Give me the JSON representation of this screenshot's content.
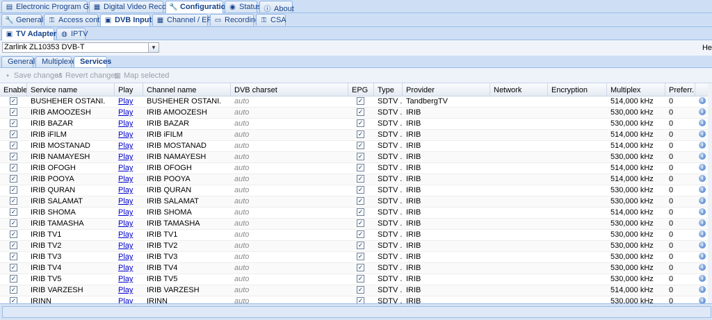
{
  "main_tabs": [
    {
      "label": "Electronic Program Guide",
      "icon": "book-icon"
    },
    {
      "label": "Digital Video Recorder",
      "icon": "film-icon"
    },
    {
      "label": "Configuration",
      "icon": "wrench-icon"
    },
    {
      "label": "Status",
      "icon": "eye-icon"
    },
    {
      "label": "About",
      "icon": "info-icon"
    }
  ],
  "config_tabs": [
    {
      "label": "General",
      "icon": "wrench-icon"
    },
    {
      "label": "Access control",
      "icon": "key-icon"
    },
    {
      "label": "DVB Inputs",
      "icon": "tv-icon"
    },
    {
      "label": "Channel / EPG",
      "icon": "table-icon"
    },
    {
      "label": "Recording",
      "icon": "drive-icon"
    },
    {
      "label": "CSA",
      "icon": "key-icon"
    }
  ],
  "dvb_tabs": [
    {
      "label": "TV Adapters",
      "icon": "tv-icon"
    },
    {
      "label": "IPTV",
      "icon": "globe-icon"
    }
  ],
  "adapter": {
    "selected": "Zarlink ZL10353 DVB-T"
  },
  "help_label": "He",
  "sub_tabs": [
    {
      "label": "General"
    },
    {
      "label": "Multiplexes"
    },
    {
      "label": "Services"
    }
  ],
  "toolbar": {
    "save": "Save changes",
    "revert": "Revert changes",
    "map": "Map selected"
  },
  "columns": [
    "Enabled",
    "Service name",
    "Play",
    "Channel name",
    "DVB charset",
    "EPG",
    "Type",
    "Provider",
    "Network",
    "Encryption",
    "Multiplex",
    "Preferr..."
  ],
  "rows": [
    {
      "service": "BUSHEHER OSTANI.",
      "play": "Play",
      "channel": "BUSHEHER OSTANI.",
      "charset": "auto",
      "type": "SDTV ...",
      "provider": "TandbergTV",
      "network": "",
      "encryption": "",
      "multiplex": "514,000 kHz",
      "pref": "0"
    },
    {
      "service": "IRIB AMOOZESH",
      "play": "Play",
      "channel": "IRIB AMOOZESH",
      "charset": "auto",
      "type": "SDTV ...",
      "provider": "IRIB",
      "network": "",
      "encryption": "",
      "multiplex": "530,000 kHz",
      "pref": "0"
    },
    {
      "service": "IRIB BAZAR",
      "play": "Play",
      "channel": "IRIB BAZAR",
      "charset": "auto",
      "type": "SDTV ...",
      "provider": "IRIB",
      "network": "",
      "encryption": "",
      "multiplex": "530,000 kHz",
      "pref": "0"
    },
    {
      "service": "IRIB iFILM",
      "play": "Play",
      "channel": "IRIB iFILM",
      "charset": "auto",
      "type": "SDTV ...",
      "provider": "IRIB",
      "network": "",
      "encryption": "",
      "multiplex": "514,000 kHz",
      "pref": "0"
    },
    {
      "service": "IRIB MOSTANAD",
      "play": "Play",
      "channel": "IRIB MOSTANAD",
      "charset": "auto",
      "type": "SDTV ...",
      "provider": "IRIB",
      "network": "",
      "encryption": "",
      "multiplex": "514,000 kHz",
      "pref": "0"
    },
    {
      "service": "IRIB NAMAYESH",
      "play": "Play",
      "channel": "IRIB NAMAYESH",
      "charset": "auto",
      "type": "SDTV ...",
      "provider": "IRIB",
      "network": "",
      "encryption": "",
      "multiplex": "530,000 kHz",
      "pref": "0"
    },
    {
      "service": "IRIB OFOGH",
      "play": "Play",
      "channel": "IRIB OFOGH",
      "charset": "auto",
      "type": "SDTV ...",
      "provider": "IRIB",
      "network": "",
      "encryption": "",
      "multiplex": "514,000 kHz",
      "pref": "0"
    },
    {
      "service": "IRIB POOYA",
      "play": "Play",
      "channel": "IRIB POOYA",
      "charset": "auto",
      "type": "SDTV ...",
      "provider": "IRIB",
      "network": "",
      "encryption": "",
      "multiplex": "514,000 kHz",
      "pref": "0"
    },
    {
      "service": "IRIB QURAN",
      "play": "Play",
      "channel": "IRIB QURAN",
      "charset": "auto",
      "type": "SDTV ...",
      "provider": "IRIB",
      "network": "",
      "encryption": "",
      "multiplex": "530,000 kHz",
      "pref": "0"
    },
    {
      "service": "IRIB SALAMAT",
      "play": "Play",
      "channel": "IRIB SALAMAT",
      "charset": "auto",
      "type": "SDTV ...",
      "provider": "IRIB",
      "network": "",
      "encryption": "",
      "multiplex": "530,000 kHz",
      "pref": "0"
    },
    {
      "service": "IRIB SHOMA",
      "play": "Play",
      "channel": "IRIB SHOMA",
      "charset": "auto",
      "type": "SDTV ...",
      "provider": "IRIB",
      "network": "",
      "encryption": "",
      "multiplex": "514,000 kHz",
      "pref": "0"
    },
    {
      "service": "IRIB TAMASHA",
      "play": "Play",
      "channel": "IRIB TAMASHA",
      "charset": "auto",
      "type": "SDTV ...",
      "provider": "IRIB",
      "network": "",
      "encryption": "",
      "multiplex": "530,000 kHz",
      "pref": "0"
    },
    {
      "service": "IRIB TV1",
      "play": "Play",
      "channel": "IRIB TV1",
      "charset": "auto",
      "type": "SDTV ...",
      "provider": "IRIB",
      "network": "",
      "encryption": "",
      "multiplex": "530,000 kHz",
      "pref": "0"
    },
    {
      "service": "IRIB TV2",
      "play": "Play",
      "channel": "IRIB TV2",
      "charset": "auto",
      "type": "SDTV ...",
      "provider": "IRIB",
      "network": "",
      "encryption": "",
      "multiplex": "530,000 kHz",
      "pref": "0"
    },
    {
      "service": "IRIB TV3",
      "play": "Play",
      "channel": "IRIB TV3",
      "charset": "auto",
      "type": "SDTV ...",
      "provider": "IRIB",
      "network": "",
      "encryption": "",
      "multiplex": "530,000 kHz",
      "pref": "0"
    },
    {
      "service": "IRIB TV4",
      "play": "Play",
      "channel": "IRIB TV4",
      "charset": "auto",
      "type": "SDTV ...",
      "provider": "IRIB",
      "network": "",
      "encryption": "",
      "multiplex": "530,000 kHz",
      "pref": "0"
    },
    {
      "service": "IRIB TV5",
      "play": "Play",
      "channel": "IRIB TV5",
      "charset": "auto",
      "type": "SDTV ...",
      "provider": "IRIB",
      "network": "",
      "encryption": "",
      "multiplex": "530,000 kHz",
      "pref": "0"
    },
    {
      "service": "IRIB VARZESH",
      "play": "Play",
      "channel": "IRIB VARZESH",
      "charset": "auto",
      "type": "SDTV ...",
      "provider": "IRIB",
      "network": "",
      "encryption": "",
      "multiplex": "514,000 kHz",
      "pref": "0"
    },
    {
      "service": "IRINN",
      "play": "Play",
      "channel": "IRINN",
      "charset": "auto",
      "type": "SDTV ...",
      "provider": "IRIB",
      "network": "",
      "encryption": "",
      "multiplex": "530,000 kHz",
      "pref": "0"
    }
  ]
}
